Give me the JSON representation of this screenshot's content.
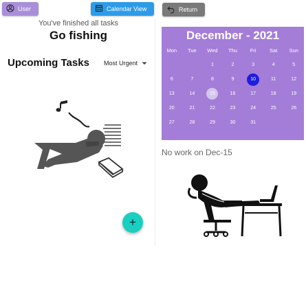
{
  "header": {
    "user_label": "User",
    "calendar_view_label": "Calendar View",
    "return_label": "Return"
  },
  "left": {
    "finished_text": "You've finished all tasks",
    "headline": "Go fishing",
    "section_title": "Upcoming Tasks",
    "sort_value": "Most Urgent",
    "fab_label": "+"
  },
  "calendar": {
    "title": "December - 2021",
    "weekdays": [
      "Mon",
      "Tue",
      "Wed",
      "Thu",
      "Fri",
      "Sat",
      "Sun"
    ],
    "weeks": [
      [
        "",
        "",
        "1",
        "2",
        "3",
        "4",
        "5"
      ],
      [
        "6",
        "7",
        "8",
        "9",
        "10",
        "11",
        "12"
      ],
      [
        "13",
        "14",
        "15",
        "16",
        "17",
        "18",
        "19"
      ],
      [
        "20",
        "21",
        "22",
        "23",
        "24",
        "25",
        "26"
      ],
      [
        "27",
        "28",
        "29",
        "30",
        "31",
        "",
        ""
      ]
    ],
    "today": "10",
    "selected": "15",
    "today_color": "#1e1ee0",
    "background_color": "#a47dd8"
  },
  "right": {
    "no_work_text": "No work on Dec-15"
  },
  "icons": {
    "user": "user-circle-icon",
    "calendar": "calendar-icon",
    "return": "undo-arrow-icon",
    "sort": "chevron-down-icon"
  }
}
